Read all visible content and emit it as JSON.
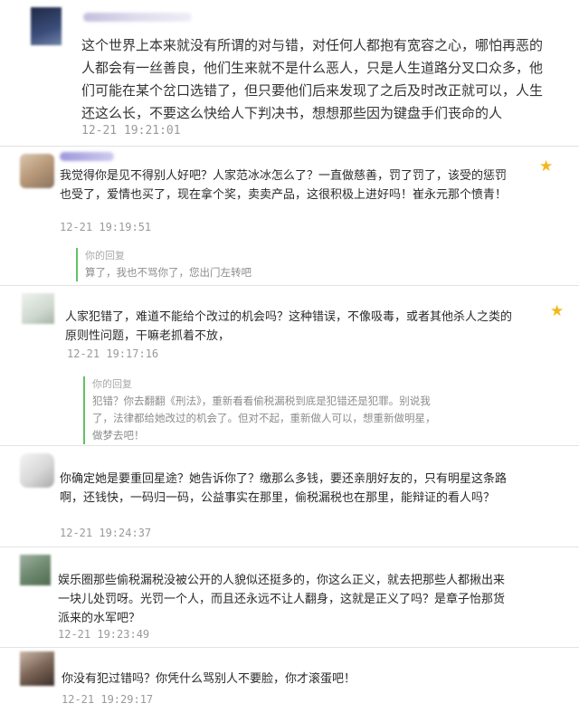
{
  "comments": [
    {
      "text": "这个世界上本来就没有所谓的对与错，对任何人都抱有宽容之心，哪怕再恶的人都会有一丝善良，他们生来就不是什么恶人，只是人生道路分叉口众多，他们可能在某个岔口选错了，但只要他们后来发现了之后及时改正就可以，人生还这么长，不要这么快给人下判决书，想想那些因为键盘手们丧命的人",
      "time": "12-21 19:21:01"
    },
    {
      "text": "我觉得你是见不得别人好吧？人家范冰冰怎么了？一直做慈善，罚了罚了，该受的惩罚也受了，爱情也买了，现在拿个奖，卖卖产品，这很积极上进好吗！崔永元那个愤青！",
      "time": "12-21 19:19:51",
      "reply_label": "你的回复",
      "reply_text": "算了，我也不骂你了，您出门左转吧"
    },
    {
      "text": "人家犯错了，难道不能给个改过的机会吗？这种错误，不像吸毒，或者其他杀人之类的原则性问题，干嘛老抓着不放，",
      "time": "12-21 19:17:16",
      "reply_label": "你的回复",
      "reply_text": "犯错？你去翻翻《刑法》，重新看看偷税漏税到底是犯错还是犯罪。别说我了，法律都给她改过的机会了。但对不起，重新做人可以，想重新做明星，做梦去吧！"
    },
    {
      "text": "你确定她是要重回星途？她告诉你了？缴那么多钱，要还亲朋好友的，只有明星这条路啊，还钱快，一码归一码，公益事实在那里，偷税漏税也在那里，能辩证的看人吗？",
      "time": "12-21 19:24:37"
    },
    {
      "text": "娱乐圈那些偷税漏税没被公开的人貌似还挺多的，你这么正义，就去把那些人都揪出来一块儿处罚呀。光罚一个人，而且还永远不让人翻身，这就是正义了吗？是章子怡那货派来的水军吧？",
      "time": "12-21 19:23:49"
    },
    {
      "text": "你没有犯过错吗？你凭什么骂别人不要脸，你才滚蛋吧！",
      "time": "12-21 19:29:17"
    }
  ],
  "colors": {
    "star": "#f2b81d",
    "reply_bar": "#63c165",
    "time": "#9a9a9a"
  },
  "icons": {
    "star": "star-icon",
    "avatar": "avatar"
  }
}
